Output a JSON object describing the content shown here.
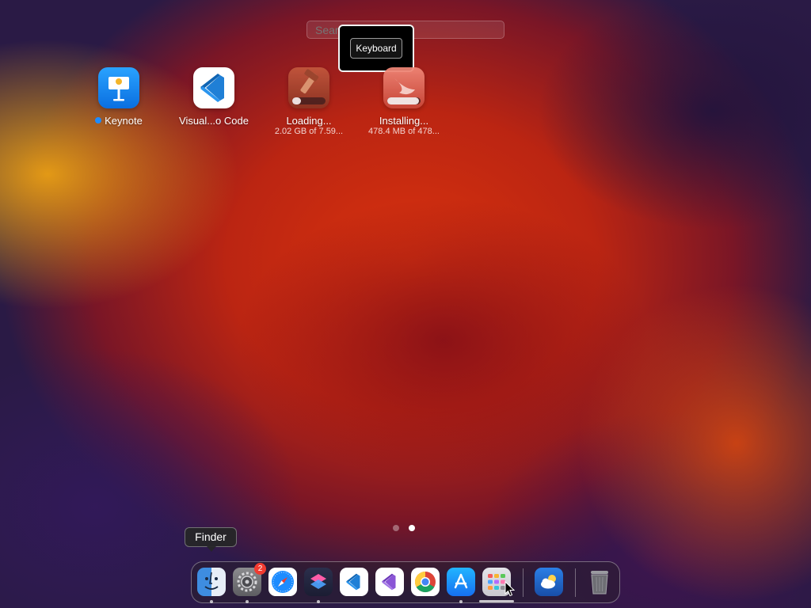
{
  "search": {
    "placeholder": "Search"
  },
  "tooltip_keyboard": {
    "label": "Keyboard"
  },
  "apps": [
    {
      "name": "Keynote",
      "status": "",
      "new": true
    },
    {
      "name": "Visual...o Code",
      "status": ""
    },
    {
      "name": "Loading...",
      "status": "2.02 GB of 7.59...",
      "progress": 0.27
    },
    {
      "name": "Installing...",
      "status": "478.4 MB of 478...",
      "progress": 0.95
    }
  ],
  "page_indicator": {
    "count": 2,
    "active": 2
  },
  "dock": {
    "tooltip": "Finder",
    "items": [
      {
        "name": "Finder",
        "icon": "finder-icon",
        "running": true
      },
      {
        "name": "System Settings",
        "icon": "settings-gear-icon",
        "badge": "2",
        "running": true
      },
      {
        "name": "Safari",
        "icon": "compass-icon",
        "running": false
      },
      {
        "name": "Shortcuts",
        "icon": "shortcuts-icon",
        "running": true
      },
      {
        "name": "Visual Studio Code",
        "icon": "vscode-icon",
        "running": false
      },
      {
        "name": "Visual Studio",
        "icon": "visual-studio-icon",
        "running": false
      },
      {
        "name": "Google Chrome",
        "icon": "chrome-icon",
        "running": false
      },
      {
        "name": "App Store",
        "icon": "app-store-icon",
        "running": true
      },
      {
        "name": "Launchpad",
        "icon": "launchpad-grid-icon",
        "running": false
      },
      {
        "name": "Weather",
        "icon": "weather-cloud-icon",
        "running": false
      },
      {
        "name": "Trash",
        "icon": "trash-icon",
        "running": false
      }
    ]
  },
  "colors": {
    "accent_blue": "#1d8cff",
    "badge_red": "#f23b30"
  }
}
